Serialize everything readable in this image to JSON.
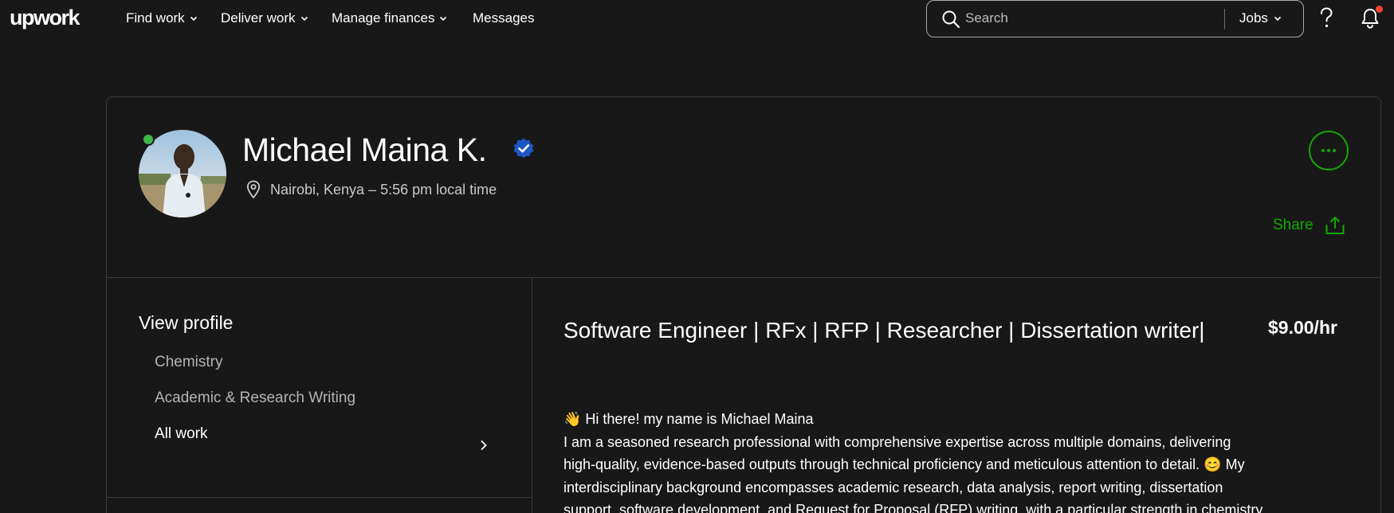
{
  "nav": {
    "logo": "upwork",
    "items": [
      {
        "label": "Find work",
        "has_dropdown": true
      },
      {
        "label": "Deliver work",
        "has_dropdown": true
      },
      {
        "label": "Manage finances",
        "has_dropdown": true
      },
      {
        "label": "Messages",
        "has_dropdown": false
      }
    ],
    "search_placeholder": "Search",
    "search_scope": "Jobs",
    "help_icon": "question-mark-icon",
    "notifications_icon": "bell-icon",
    "notification_indicator_color": "#f2432f"
  },
  "profile": {
    "name": "Michael Maina K.",
    "verified": true,
    "online": true,
    "location": "Nairobi, Kenya – 5:56 pm local time",
    "more_icon": "ellipsis-icon",
    "share_label": "Share",
    "share_icon": "share-icon"
  },
  "sidebar": {
    "title": "View profile",
    "items": [
      {
        "label": "Chemistry",
        "active": false
      },
      {
        "label": "Academic & Research Writing",
        "active": false
      },
      {
        "label": "All work",
        "active": true
      }
    ]
  },
  "main": {
    "headline": "Software Engineer | RFx | RFP | Researcher | Dissertation writer|",
    "rate": "$9.00/hr",
    "bio_lines": [
      "👋 Hi there! my name is Michael Maina",
      "I am a seasoned research professional with comprehensive expertise across multiple domains, delivering",
      "high-quality, evidence-based outputs through technical proficiency and meticulous attention to detail. 😊 My",
      "interdisciplinary background encompasses academic research, data analysis, report writing, dissertation",
      "support, software development, and Request for Proposal (RFP) writing, with a particular strength in chemistry"
    ]
  },
  "colors": {
    "background": "#181818",
    "accent_green": "#14a800",
    "online_green": "#3fb64a",
    "verified_blue": "#1f57c3",
    "border": "#3a3a3a",
    "muted_text": "#b5b5b5"
  }
}
